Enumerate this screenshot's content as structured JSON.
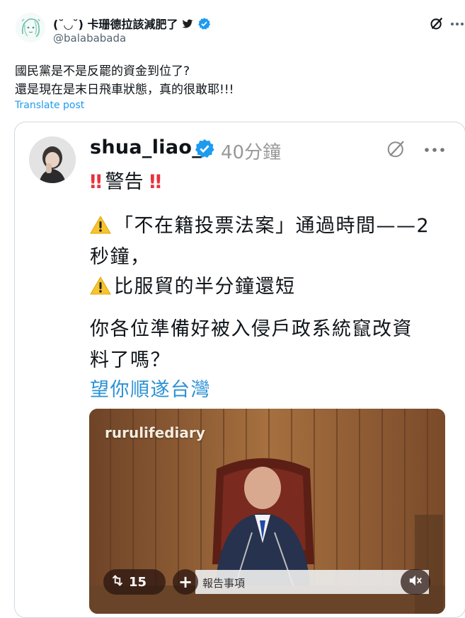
{
  "post": {
    "display_name": "(˘◡˘) 卡珊德拉該減肥了",
    "handle": "@balababada",
    "text_line1": "國民黨是不是反罷的資金到位了?",
    "text_line2": "還是現在是末日飛車狀態，真的很敢耶!!!",
    "translate_label": "Translate post"
  },
  "embedded": {
    "username": "shua_liao_",
    "time": "40分鐘",
    "warning_title": "警告",
    "bangs": "‼",
    "line1": "「不在籍投票法案」通過時間——2",
    "line2": "秒鐘，",
    "line3": "比服貿的半分鐘還短",
    "line4": "你各位準備好被入侵戶政系統竄改資",
    "line5": "料了嗎？",
    "link_text": "望你順遂台灣"
  },
  "video": {
    "watermark": "rurulifediary",
    "repost_count": "15",
    "caption": "報告事項"
  },
  "colors": {
    "link": "#1d9bf0",
    "verified": "#1d9bf0",
    "warn_red": "#e8323c",
    "embedded_link": "#2a91d6"
  },
  "icons": [
    "twitter-bird-icon",
    "verified-icon",
    "grok-icon",
    "more-icon",
    "warning-icon",
    "repost-icon",
    "plus-icon",
    "mute-icon"
  ]
}
